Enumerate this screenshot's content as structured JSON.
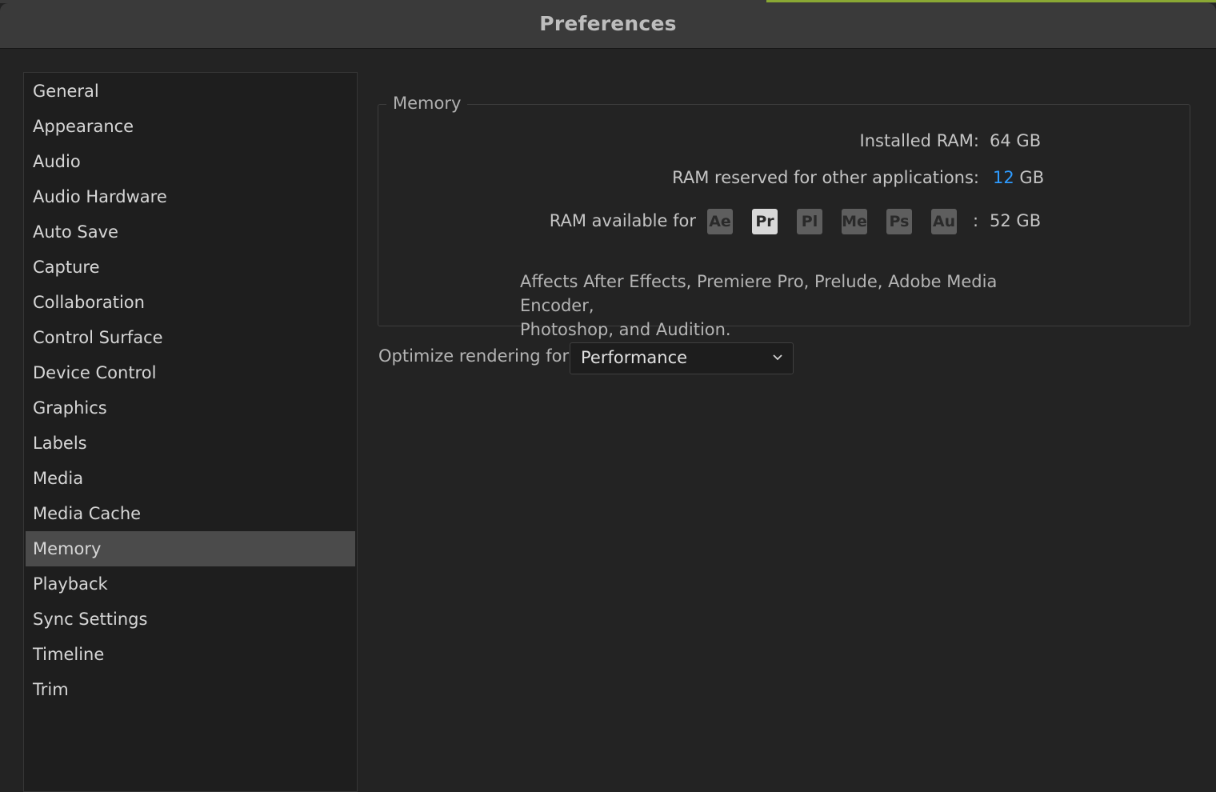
{
  "window": {
    "title": "Preferences"
  },
  "sidebar": {
    "items": [
      {
        "label": "General"
      },
      {
        "label": "Appearance"
      },
      {
        "label": "Audio"
      },
      {
        "label": "Audio Hardware"
      },
      {
        "label": "Auto Save"
      },
      {
        "label": "Capture"
      },
      {
        "label": "Collaboration"
      },
      {
        "label": "Control Surface"
      },
      {
        "label": "Device Control"
      },
      {
        "label": "Graphics"
      },
      {
        "label": "Labels"
      },
      {
        "label": "Media"
      },
      {
        "label": "Media Cache"
      },
      {
        "label": "Memory",
        "selected": true
      },
      {
        "label": "Playback"
      },
      {
        "label": "Sync Settings"
      },
      {
        "label": "Timeline"
      },
      {
        "label": "Trim"
      }
    ]
  },
  "memory": {
    "legend": "Memory",
    "installed_label": "Installed RAM:",
    "installed_value": "64",
    "installed_unit": "GB",
    "reserved_label": "RAM reserved for other applications:",
    "reserved_value": "12",
    "reserved_unit": "GB",
    "available_label": "RAM available for",
    "apps": [
      "Ae",
      "Pr",
      "Pl",
      "Me",
      "Ps",
      "Au"
    ],
    "active_app": "Pr",
    "colon": ":",
    "available_value": "52",
    "available_unit": "GB",
    "note_line1": "Affects After Effects, Premiere Pro, Prelude, Adobe Media Encoder,",
    "note_line2": "Photoshop, and Audition."
  },
  "rendering": {
    "label": "Optimize rendering for:",
    "selected": "Performance"
  },
  "colors": {
    "accent": "#2e9bff",
    "selection": "#4b4b4b",
    "background": "#232323"
  },
  "icons": {
    "dropdown": "chevron-down-icon"
  }
}
